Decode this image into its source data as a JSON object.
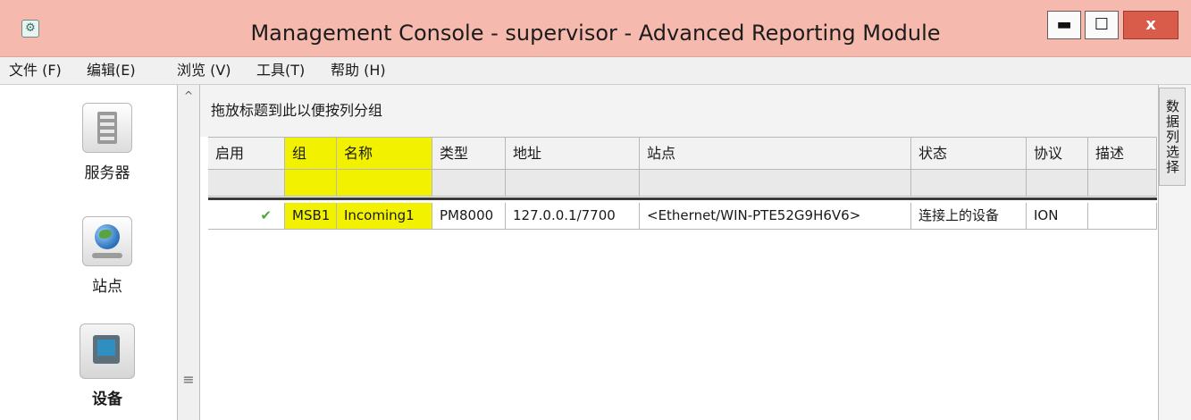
{
  "window": {
    "title": "Management Console - supervisor - Advanced Reporting Module",
    "minimize_label": "▬",
    "maximize_label": "☐",
    "close_label": "x"
  },
  "menu": {
    "items": [
      {
        "label": "文件 (F)"
      },
      {
        "label": "编辑(E)"
      },
      {
        "label": "浏览 (V)"
      },
      {
        "label": "工具(T)"
      },
      {
        "label": "帮助 (H)"
      }
    ]
  },
  "nav": {
    "items": [
      {
        "label": "服务器",
        "icon": "server-icon"
      },
      {
        "label": "站点",
        "icon": "globe-icon"
      },
      {
        "label": "设备",
        "icon": "device-icon",
        "selected": true
      }
    ]
  },
  "grid": {
    "group_hint": "拖放标题到此以便按列分组",
    "columns": [
      "启用",
      "组",
      "名称",
      "类型",
      "地址",
      "站点",
      "状态",
      "协议",
      "描述"
    ],
    "highlighted_columns": [
      "组",
      "名称"
    ],
    "rows": [
      {
        "enabled": "✔",
        "group": "MSB1",
        "name": "Incoming1",
        "type": "PM8000",
        "address": "127.0.0.1/7700",
        "site": "<Ethernet/WIN-PTE52G9H6V6>",
        "status": "连接上的设备",
        "protocol": "ION",
        "description": ""
      }
    ]
  },
  "side_panel": {
    "tab_label": "数据列选择"
  },
  "colors": {
    "titlebar": "#f6b9ad",
    "highlight": "#f2f200",
    "check": "#4caa3a"
  }
}
